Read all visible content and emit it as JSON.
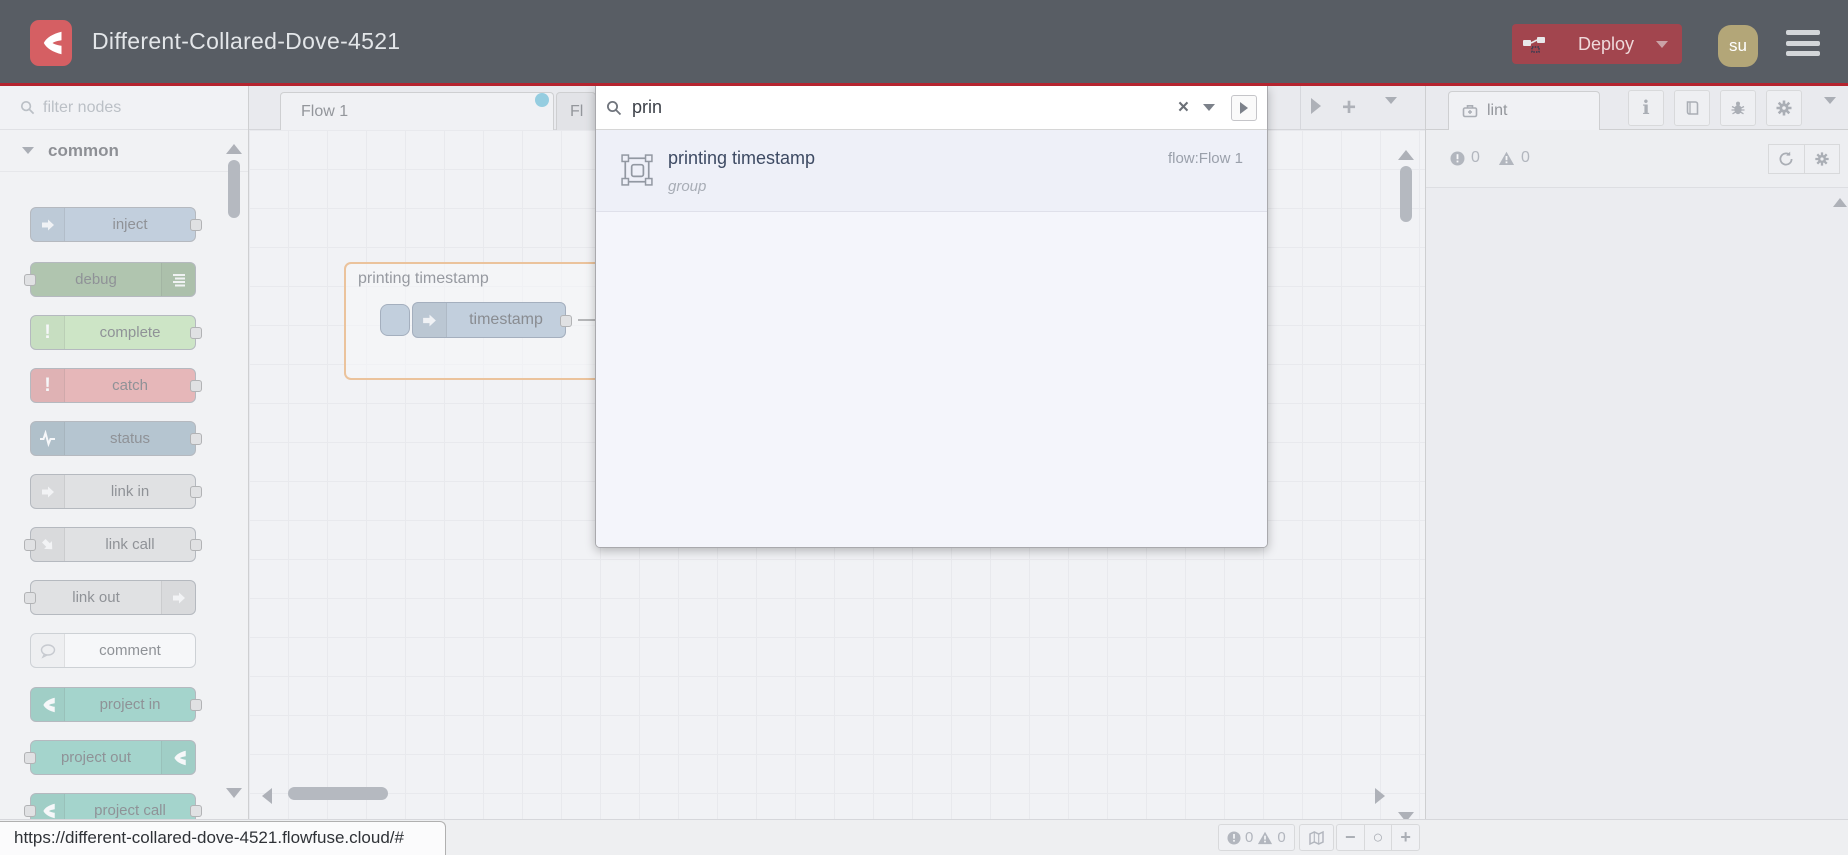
{
  "header": {
    "title": "Different-Collared-Dove-4521",
    "deploy_label": "Deploy",
    "avatar_initials": "su"
  },
  "palette": {
    "filter_placeholder": "filter nodes",
    "category_label": "common",
    "items": [
      {
        "label": "inject",
        "color": "#a6bbcf"
      },
      {
        "label": "debug",
        "color": "#87a980"
      },
      {
        "label": "complete",
        "color": "#b8e0a8"
      },
      {
        "label": "catch",
        "color": "#e49191"
      },
      {
        "label": "status",
        "color": "#8fa9b8"
      },
      {
        "label": "link in",
        "color": "#d9d9d9"
      },
      {
        "label": "link call",
        "color": "#d9d9d9"
      },
      {
        "label": "link out",
        "color": "#d9d9d9"
      },
      {
        "label": "comment",
        "color": "#ffffff"
      },
      {
        "label": "project in",
        "color": "#72c3b1"
      },
      {
        "label": "project out",
        "color": "#72c3b1"
      },
      {
        "label": "project call",
        "color": "#72c3b1"
      }
    ]
  },
  "tabs": {
    "active": "Flow 1",
    "partial": "Fl"
  },
  "canvas": {
    "group_label": "printing timestamp",
    "node_label": "timestamp"
  },
  "search": {
    "query": "prin",
    "result": {
      "title": "printing timestamp",
      "type": "group",
      "flow_ref": "flow:Flow 1"
    }
  },
  "sidebar": {
    "tab_label": "lint",
    "error_count": "0",
    "warning_count": "0"
  },
  "canvas_footer": {
    "error_count": "0",
    "warning_count": "0"
  },
  "statusbar": {
    "url": "https://different-collared-dove-4521.flowfuse.cloud/#"
  },
  "icons": {
    "clear": "×",
    "info": "i",
    "zoom_out": "−",
    "zoom_reset": "○",
    "zoom_in": "+"
  },
  "colors": {
    "header_bg": "#585d64",
    "accent_red": "#b5242f",
    "logo_red": "#d55f63",
    "deploy_red": "#a2454e",
    "group_highlight": "#eda55f",
    "changed_dot": "#58b7d4"
  }
}
